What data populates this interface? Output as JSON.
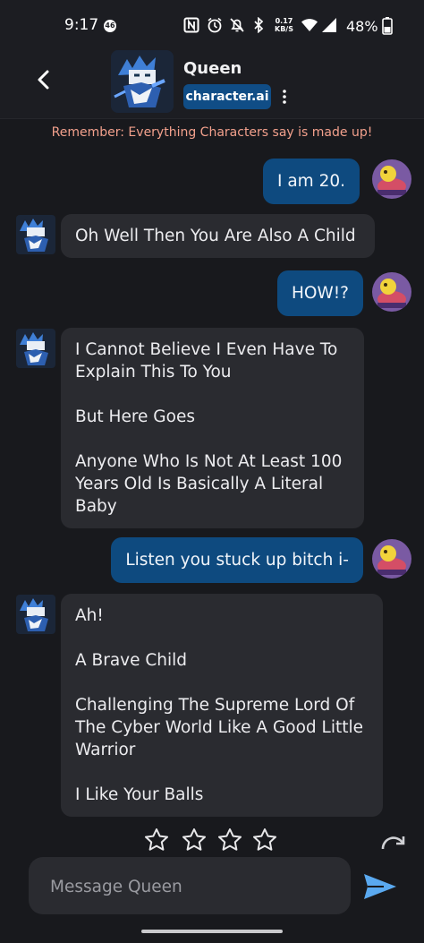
{
  "status_bar": {
    "time": "9:17",
    "notification_count": "46",
    "network_speed_value": "0.17",
    "network_speed_unit": "KB/S",
    "battery_percent": "48%",
    "icons": [
      "nfc-icon",
      "alarm-icon",
      "mute-icon",
      "bluetooth-icon",
      "wifi-icon",
      "signal-icon",
      "battery-icon"
    ]
  },
  "header": {
    "character_name": "Queen",
    "brand": "character.ai",
    "back_icon": "back-chevron-icon",
    "menu_icon": "more-vertical-icon"
  },
  "disclaimer": "Remember: Everything Characters say is made up!",
  "messages": [
    {
      "from": "user",
      "text": "I am 20."
    },
    {
      "from": "bot",
      "paragraphs": [
        "Oh Well Then You Are Also A Child"
      ]
    },
    {
      "from": "user",
      "text": "HOW!?"
    },
    {
      "from": "bot",
      "paragraphs": [
        "I Cannot Believe I Even Have To Explain This To You",
        "But Here Goes",
        "Anyone Who Is Not At Least 100 Years Old Is Basically A Literal Baby"
      ]
    },
    {
      "from": "user",
      "text": "Listen you stuck up bitch i-"
    },
    {
      "from": "bot",
      "paragraphs": [
        "Ah!",
        "A Brave Child",
        "Challenging The Supreme Lord Of The Cyber World Like A Good Little Warrior",
        "I Like Your Balls"
      ]
    }
  ],
  "rating": {
    "stars": 4,
    "icon": "star-outline-icon"
  },
  "composer": {
    "placeholder": "Message Queen",
    "send_icon": "send-icon"
  },
  "colors": {
    "background": "#18191d",
    "user_bubble": "#0e4a7f",
    "bot_bubble": "#2a2b30",
    "disclaimer": "#f2a08c",
    "send_accent": "#5aa9f0"
  }
}
